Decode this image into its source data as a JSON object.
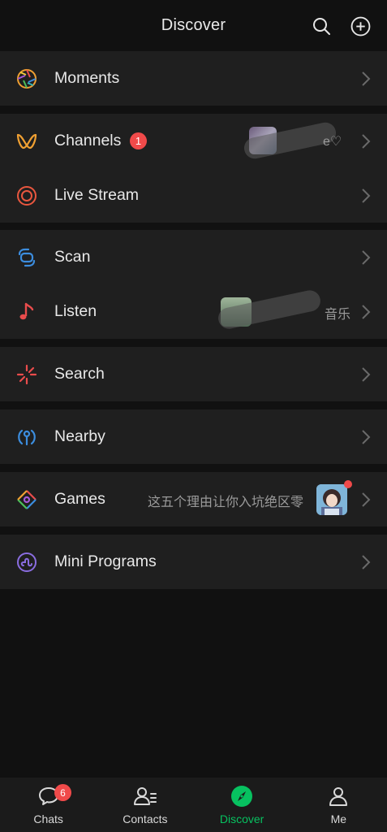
{
  "header": {
    "title": "Discover",
    "search_icon": "search-icon",
    "add_icon": "plus-circle-icon"
  },
  "items": {
    "moments": {
      "label": "Moments",
      "icon": "moments-aperture-icon"
    },
    "channels": {
      "label": "Channels",
      "badge": "1",
      "icon": "channels-icon",
      "right_text": "e♡"
    },
    "live_stream": {
      "label": "Live Stream",
      "icon": "live-stream-icon"
    },
    "scan": {
      "label": "Scan",
      "icon": "scan-icon"
    },
    "listen": {
      "label": "Listen",
      "icon": "music-note-icon",
      "right_text": "音乐"
    },
    "search": {
      "label": "Search",
      "icon": "search-sparkle-icon"
    },
    "nearby": {
      "label": "Nearby",
      "icon": "nearby-icon"
    },
    "games": {
      "label": "Games",
      "icon": "games-icon",
      "right_text": "这五个理由让你入坑绝区零"
    },
    "mini_programs": {
      "label": "Mini Programs",
      "icon": "mini-programs-icon"
    }
  },
  "tabbar": {
    "chats": {
      "label": "Chats",
      "badge": "6",
      "icon": "chat-bubble-icon"
    },
    "contacts": {
      "label": "Contacts",
      "icon": "contacts-icon"
    },
    "discover": {
      "label": "Discover",
      "icon": "compass-icon",
      "active": true
    },
    "me": {
      "label": "Me",
      "icon": "person-icon"
    }
  },
  "colors": {
    "background": "#111111",
    "cell": "#1f1f1f",
    "accent_green": "#07c160",
    "badge_red": "#f04a4a",
    "secondary_text": "#9a9a9a"
  }
}
